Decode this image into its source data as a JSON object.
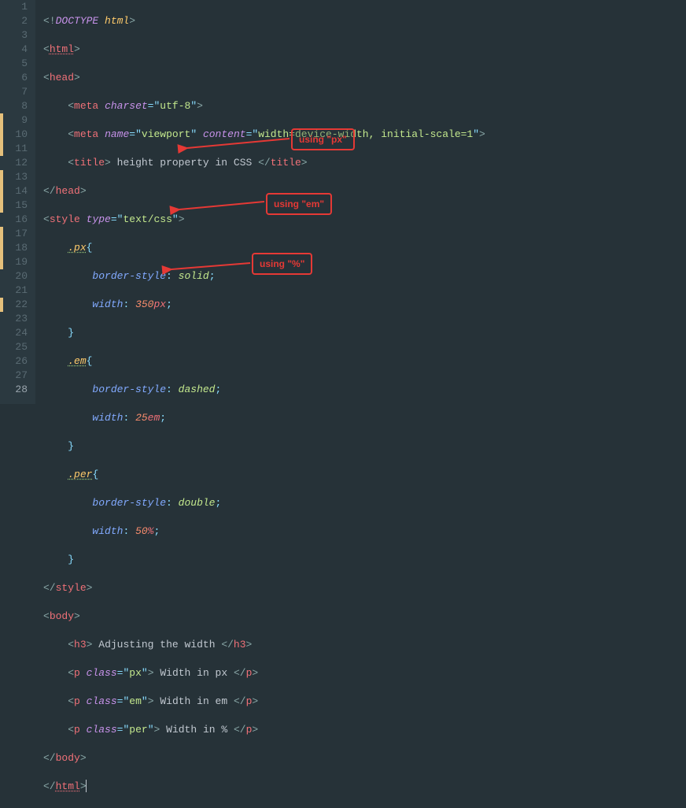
{
  "lines": [
    {
      "num": 1,
      "modified": false
    },
    {
      "num": 2,
      "modified": false
    },
    {
      "num": 3,
      "modified": false
    },
    {
      "num": 4,
      "modified": false
    },
    {
      "num": 5,
      "modified": false
    },
    {
      "num": 6,
      "modified": false
    },
    {
      "num": 7,
      "modified": false
    },
    {
      "num": 8,
      "modified": false
    },
    {
      "num": 9,
      "modified": true
    },
    {
      "num": 10,
      "modified": true
    },
    {
      "num": 11,
      "modified": true
    },
    {
      "num": 12,
      "modified": false
    },
    {
      "num": 13,
      "modified": true
    },
    {
      "num": 14,
      "modified": true
    },
    {
      "num": 15,
      "modified": true
    },
    {
      "num": 16,
      "modified": false
    },
    {
      "num": 17,
      "modified": true
    },
    {
      "num": 18,
      "modified": true
    },
    {
      "num": 19,
      "modified": true
    },
    {
      "num": 20,
      "modified": false
    },
    {
      "num": 21,
      "modified": false
    },
    {
      "num": 22,
      "modified": true
    },
    {
      "num": 23,
      "modified": false
    },
    {
      "num": 24,
      "modified": false
    },
    {
      "num": 25,
      "modified": false
    },
    {
      "num": 26,
      "modified": false
    },
    {
      "num": 27,
      "modified": false
    },
    {
      "num": 28,
      "modified": false,
      "current": true
    }
  ],
  "code": {
    "doctype_kw": "DOCTYPE",
    "doctype_val": "html",
    "tag_html": "html",
    "tag_head": "head",
    "tag_meta": "meta",
    "attr_charset": "charset",
    "val_utf8": "utf-8",
    "attr_name": "name",
    "val_viewport": "viewport",
    "attr_content": "content",
    "val_viewport_content": "width=device-width, initial-scale=1",
    "tag_title": "title",
    "title_text": "height property in CSS",
    "tag_style": "style",
    "attr_type": "type",
    "val_textcss": "text/css",
    "sel_px": ".px",
    "sel_em": ".em",
    "sel_per": ".per",
    "prop_border_style": "border-style",
    "prop_width": "width",
    "val_solid": "solid",
    "val_dashed": "dashed",
    "val_double": "double",
    "val_350": "350",
    "unit_px": "px",
    "val_25": "25",
    "unit_em": "em",
    "val_50": "50",
    "unit_pct": "%",
    "tag_body": "body",
    "tag_h3": "h3",
    "h3_text": "Adjusting the width",
    "tag_p": "p",
    "attr_class": "class",
    "class_px": "px",
    "class_em": "em",
    "class_per": "per",
    "p_px_text": "Width in px",
    "p_em_text": "Width in em",
    "p_per_text": "Width in %"
  },
  "annotations": {
    "a1": "using \"px\"",
    "a2": "using \"em\"",
    "a3": "using \"%\""
  }
}
